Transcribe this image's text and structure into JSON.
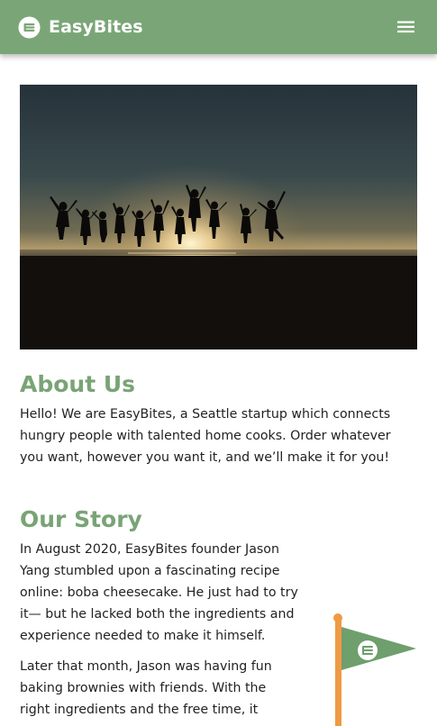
{
  "navbar": {
    "brand_name": "EasyBites",
    "brand_icon": "easybites-logo-icon",
    "menu_icon": "hamburger-menu-icon",
    "color": "#7aa677"
  },
  "hero": {
    "image": "silhouettes-jumping-at-sunset-photo"
  },
  "about": {
    "title": "About Us",
    "lines": [
      "Hello! We are EasyBites, a Seattle startup which connects",
      "hungry people with talented home cooks. Order whatever",
      "you want, however you want it, and we’ll make it for you!"
    ]
  },
  "story": {
    "title": "Our Story",
    "paragraph1_lines": [
      "In August 2020, EasyBites founder Jason",
      "Yang stumbled upon a fascinating recipe",
      "online: boba cheesecake. He just had to try",
      "it— but he lacked both the ingredients and",
      "experience needed to make it himself."
    ],
    "paragraph2_lines": [
      "Later that month, Jason was having fun",
      "baking brownies with friends. With the",
      "right ingredients and the free time, it"
    ]
  },
  "flag": {
    "icon": "easybites-pennant-flag-icon",
    "pole_color": "#ef9a45",
    "flag_color": "#6e9f6c"
  },
  "theme": {
    "heading_color": "#79a475",
    "text_color": "#222222"
  }
}
